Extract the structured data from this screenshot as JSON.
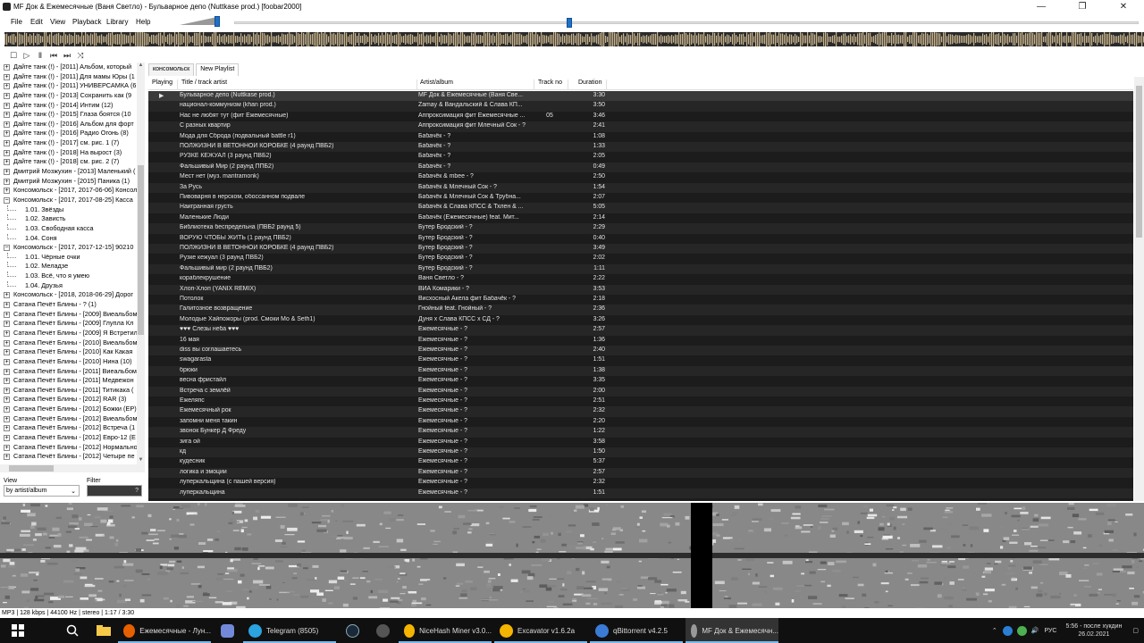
{
  "window": {
    "title": "MF Док & Ежемесячные (Ваня Светло) - Бульварное депо (Nuttkase prod.)  [foobar2000]",
    "minimize": "—",
    "maximize": "❐",
    "close": "✕"
  },
  "menu": [
    "File",
    "Edit",
    "View",
    "Playback",
    "Library",
    "Help"
  ],
  "toolbar": {
    "icons": [
      "stop-icon",
      "play-icon",
      "pause-icon",
      "previous-icon",
      "next-icon",
      "random-icon"
    ],
    "glyphs": [
      "☐",
      "▷",
      "Ⅱ",
      "⏮",
      "⏭",
      "⤨"
    ]
  },
  "tree": [
    {
      "label": "Дайте танк (!) - [2011] Альбом, который",
      "expanded": false
    },
    {
      "label": "Дайте танк (!) - [2011] Для мамы Юры (1",
      "expanded": false
    },
    {
      "label": "Дайте танк (!) - [2011] УНИВЕРСАМКА (6",
      "expanded": false
    },
    {
      "label": "Дайте танк (!) - [2013] Сохранить как (9",
      "expanded": false
    },
    {
      "label": "Дайте танк (!) - [2014] Интим (12)",
      "expanded": false
    },
    {
      "label": "Дайте танк (!) - [2015] Глаза боятся (10",
      "expanded": false
    },
    {
      "label": "Дайте танк (!) - [2016] Альбом для форт",
      "expanded": false
    },
    {
      "label": "Дайте танк (!) - [2016] Радио Огонь (8)",
      "expanded": false
    },
    {
      "label": "Дайте танк (!) - [2017] см. рис. 1 (7)",
      "expanded": false
    },
    {
      "label": "Дайте танк (!) - [2018] На вырост (3)",
      "expanded": false
    },
    {
      "label": "Дайте танк (!) - [2018] см. рис. 2 (7)",
      "expanded": false
    },
    {
      "label": "Дмитрий Мозжухин - [2013] Маленький (",
      "expanded": false
    },
    {
      "label": "Дмитрий Мозжухин - [2015] Паника (1)",
      "expanded": false
    },
    {
      "label": "Консомольск - [2017, 2017-06-06] Консол",
      "expanded": false
    },
    {
      "label": "Консомольск - [2017, 2017-08-25] Касса",
      "expanded": true
    },
    {
      "label": "1.01. Звёзды",
      "child": true
    },
    {
      "label": "1.02. Зависть",
      "child": true
    },
    {
      "label": "1.03. Свободная касса",
      "child": true
    },
    {
      "label": "1.04. Соня",
      "child": true
    },
    {
      "label": "Консомольск - [2017, 2017-12-15] 90210",
      "expanded": true
    },
    {
      "label": "1.01. Чёрные очки",
      "child": true
    },
    {
      "label": "1.02. Меладзе",
      "child": true
    },
    {
      "label": "1.03. Всё, что я умею",
      "child": true
    },
    {
      "label": "1.04. Друзья",
      "child": true
    },
    {
      "label": "Консомольск - [2018, 2018-06-29] Дорог",
      "expanded": false
    },
    {
      "label": "Сатана Печёт Блины - ? (1)",
      "expanded": false
    },
    {
      "label": "Сатана Печёт Блины - [2009] Виеальбом",
      "expanded": false
    },
    {
      "label": "Сатана Печёт Блины - [2009] Глупла Кл",
      "expanded": false
    },
    {
      "label": "Сатана Печёт Блины - [2009] Я Встретил",
      "expanded": false
    },
    {
      "label": "Сатана Печёт Блины - [2010] Виеальбом",
      "expanded": false
    },
    {
      "label": "Сатана Печёт Блины - [2010] Как Какая",
      "expanded": false
    },
    {
      "label": "Сатана Печёт Блины - [2010] Нина (10)",
      "expanded": false
    },
    {
      "label": "Сатана Печёт Блины - [2011] Виеальбом",
      "expanded": false
    },
    {
      "label": "Сатана Печёт Блины - [2011] Медвежон",
      "expanded": false
    },
    {
      "label": "Сатана Печёт Блины - [2011] Титикака (",
      "expanded": false
    },
    {
      "label": "Сатана Печёт Блины - [2012] RAR (3)",
      "expanded": false
    },
    {
      "label": "Сатана Печёт Блины - [2012] Божки (EP)",
      "expanded": false
    },
    {
      "label": "Сатана Печёт Блины - [2012] Виеальбом",
      "expanded": false
    },
    {
      "label": "Сатана Печёт Блины - [2012] Встреча (1",
      "expanded": false
    },
    {
      "label": "Сатана Печёт Блины - [2012] Евро-12 (E",
      "expanded": false
    },
    {
      "label": "Сатана Печёт Блины - [2012] Нормально",
      "expanded": false
    },
    {
      "label": "Сатана Печёт Блины - [2012] Четыре пе",
      "expanded": false
    }
  ],
  "view": {
    "label": "View",
    "value": "by artist/album",
    "arrow": "⌄"
  },
  "filter": {
    "label": "Filter",
    "button": "?"
  },
  "tabs": [
    {
      "label": "консомольск",
      "active": false
    },
    {
      "label": "New Playlist",
      "active": true
    }
  ],
  "columns": {
    "playing": "Playing",
    "title": "Title / track artist",
    "artist": "Artist/album",
    "track": "Track no",
    "duration": "Duration"
  },
  "playlist": [
    {
      "title": "Бульварное депо (Nuttkase prod.)",
      "artist": "MF Док & Ежемесячные (Ваня Све...",
      "track": "",
      "dur": "3:30",
      "playing": true
    },
    {
      "title": "национал-коммунизм (khan prod.)",
      "artist": "Zamay & Вандальский & Слава КП...",
      "track": "",
      "dur": "3:50"
    },
    {
      "title": "Нас не любят тут (фит Ежемесячные)",
      "artist": "Аппроксимация фит Ежемесячные ...",
      "track": "05",
      "dur": "3:46"
    },
    {
      "title": "С разных квартир",
      "artist": "Аппроксимация фит Млечный Сок - ?",
      "track": "",
      "dur": "2:41"
    },
    {
      "title": "Мода для Сброда (подвальный battle r1)",
      "artist": "Бабачёк - ?",
      "track": "",
      "dur": "1:08"
    },
    {
      "title": "ПОЛЖИЗНИ В ВЕТОННОЙ КОРОБКЕ (4 раунд ПВБ2)",
      "artist": "Бабачёк - ?",
      "track": "",
      "dur": "1:33"
    },
    {
      "title": "РУЗКЕ КЕЖУАЛ (3 раунд ПВБ2)",
      "artist": "Бабачёк - ?",
      "track": "",
      "dur": "2:05"
    },
    {
      "title": "Фальшивый Мир (2 раунд ППБ2)",
      "artist": "Бабачёк - ?",
      "track": "",
      "dur": "0:49"
    },
    {
      "title": "Мест нет (муз. mantramonk)",
      "artist": "Бабачёк & mbee - ?",
      "track": "",
      "dur": "2:50"
    },
    {
      "title": "За Русь",
      "artist": "Бабачёк & Млечный Сок - ?",
      "track": "",
      "dur": "1:54"
    },
    {
      "title": "Пивоварня в нерском, обоссанном подвале",
      "artist": "Бабачёк & Млечный Сок & Трубна...",
      "track": "",
      "dur": "2:07"
    },
    {
      "title": "Наигранная грусть",
      "artist": "Бабачёк & Слава КПСС & Тхлен & ...",
      "track": "",
      "dur": "5:05"
    },
    {
      "title": "Маленькие Люди",
      "artist": "Бабачёк (Ежемесячные) feat. Мит...",
      "track": "",
      "dur": "2:14"
    },
    {
      "title": "Библиотека беспредельна (ПВБ2 раунд 5)",
      "artist": "Бутер Бродский - ?",
      "track": "",
      "dur": "2:29"
    },
    {
      "title": "ВОРУЮ ЧТОБЫ ЖИТЬ (1 раунд ПВБ2)",
      "artist": "Бутер Бродский - ?",
      "track": "",
      "dur": "0:40"
    },
    {
      "title": "ПОЛЖИЗНИ В ВЕТОННОЙ КОРОБКЕ (4 раунд ПВБ2)",
      "artist": "Бутер Бродский - ?",
      "track": "",
      "dur": "3:49"
    },
    {
      "title": "Рузке кежуал (3 раунд ПВБ2)",
      "artist": "Бутер Бродский - ?",
      "track": "",
      "dur": "2:02"
    },
    {
      "title": "Фальшивый мир (2 раунд ПВБ2)",
      "artist": "Бутер Бродский - ?",
      "track": "",
      "dur": "1:11"
    },
    {
      "title": "кораблекрушение",
      "artist": "Ваня Светло - ?",
      "track": "",
      "dur": "2:22"
    },
    {
      "title": "Хлоп-Хлоп (YANIX REMIX)",
      "artist": "ВИА Комарики - ?",
      "track": "",
      "dur": "3:53"
    },
    {
      "title": "Потолок",
      "artist": "Висхосный Акела фит Бабачёк - ?",
      "track": "",
      "dur": "2:18"
    },
    {
      "title": "Галитозное возвращение",
      "artist": "Гнойный feat. Гнойный - ?",
      "track": "",
      "dur": "2:36"
    },
    {
      "title": "Молодые Хайпожоры (prod. Смоки Мо & Seth1)",
      "artist": "Дуня х Слава КПСС х СД - ?",
      "track": "",
      "dur": "3:26"
    },
    {
      "title": "♥♥♥ Слезы неба ♥♥♥",
      "artist": "Ежемесячные - ?",
      "track": "",
      "dur": "2:57"
    },
    {
      "title": "16 мая",
      "artist": "Ежемесячные - ?",
      "track": "",
      "dur": "1:36"
    },
    {
      "title": "diss вы соглашаетесь",
      "artist": "Ежемесячные - ?",
      "track": "",
      "dur": "2:40"
    },
    {
      "title": "swagarasta",
      "artist": "Ежемесячные - ?",
      "track": "",
      "dur": "1:51"
    },
    {
      "title": "брюки",
      "artist": "Ежемесячные - ?",
      "track": "",
      "dur": "1:38"
    },
    {
      "title": "весна фристайл",
      "artist": "Ежемесячные - ?",
      "track": "",
      "dur": "3:35"
    },
    {
      "title": "Встреча с землёй",
      "artist": "Ежемесячные - ?",
      "track": "",
      "dur": "2:00"
    },
    {
      "title": "Ежеляпс",
      "artist": "Ежемесячные - ?",
      "track": "",
      "dur": "2:51"
    },
    {
      "title": "Ежемесячный рок",
      "artist": "Ежемесячные - ?",
      "track": "",
      "dur": "2:32"
    },
    {
      "title": "запомни меня такин",
      "artist": "Ежемесячные - ?",
      "track": "",
      "dur": "2:20"
    },
    {
      "title": "звонок Бункер Д Фреду",
      "artist": "Ежемесячные - ?",
      "track": "",
      "dur": "1:22"
    },
    {
      "title": "зига ой",
      "artist": "Ежемесячные - ?",
      "track": "",
      "dur": "3:58"
    },
    {
      "title": "кд",
      "artist": "Ежемесячные - ?",
      "track": "",
      "dur": "1:50"
    },
    {
      "title": "кудесник",
      "artist": "Ежемесячные - ?",
      "track": "",
      "dur": "5:37"
    },
    {
      "title": "логика и эмоции",
      "artist": "Ежемесячные - ?",
      "track": "",
      "dur": "2:57"
    },
    {
      "title": "луперкальщина (с пашей версия)",
      "artist": "Ежемесячные - ?",
      "track": "",
      "dur": "2:32"
    },
    {
      "title": "луперкальщина",
      "artist": "Ежемесячные - ?",
      "track": "",
      "dur": "1:51"
    }
  ],
  "playing_glyph": "▶",
  "status": "MP3 | 128 kbps | 44100 Hz | stereo | 1:17 / 3:30",
  "volume_level": 0.85,
  "seek_fraction": 0.37,
  "taskbar": {
    "items": [
      {
        "label": "Ежемесячные - Лун...",
        "icon": "firefox-icon",
        "color": "#e66000"
      },
      {
        "label": "Telegram (8505)",
        "icon": "telegram-icon",
        "color": "#2aa3e0"
      },
      {
        "label": "NiceHash Miner v3.0...",
        "icon": "nicehash-icon",
        "color": "#f5b400"
      },
      {
        "label": "Excavator v1.6.2a",
        "icon": "excavator-icon",
        "color": "#f5b400"
      },
      {
        "label": "qBittorrent v4.2.5",
        "icon": "qbittorrent-icon",
        "color": "#3a7bd5"
      },
      {
        "label": "MF Док & Ежемесячн...",
        "icon": "foobar-icon",
        "color": "#999999"
      }
    ],
    "lang": "РУС",
    "time": "5:56 - после хүкдин",
    "date": "26.02.2021"
  }
}
